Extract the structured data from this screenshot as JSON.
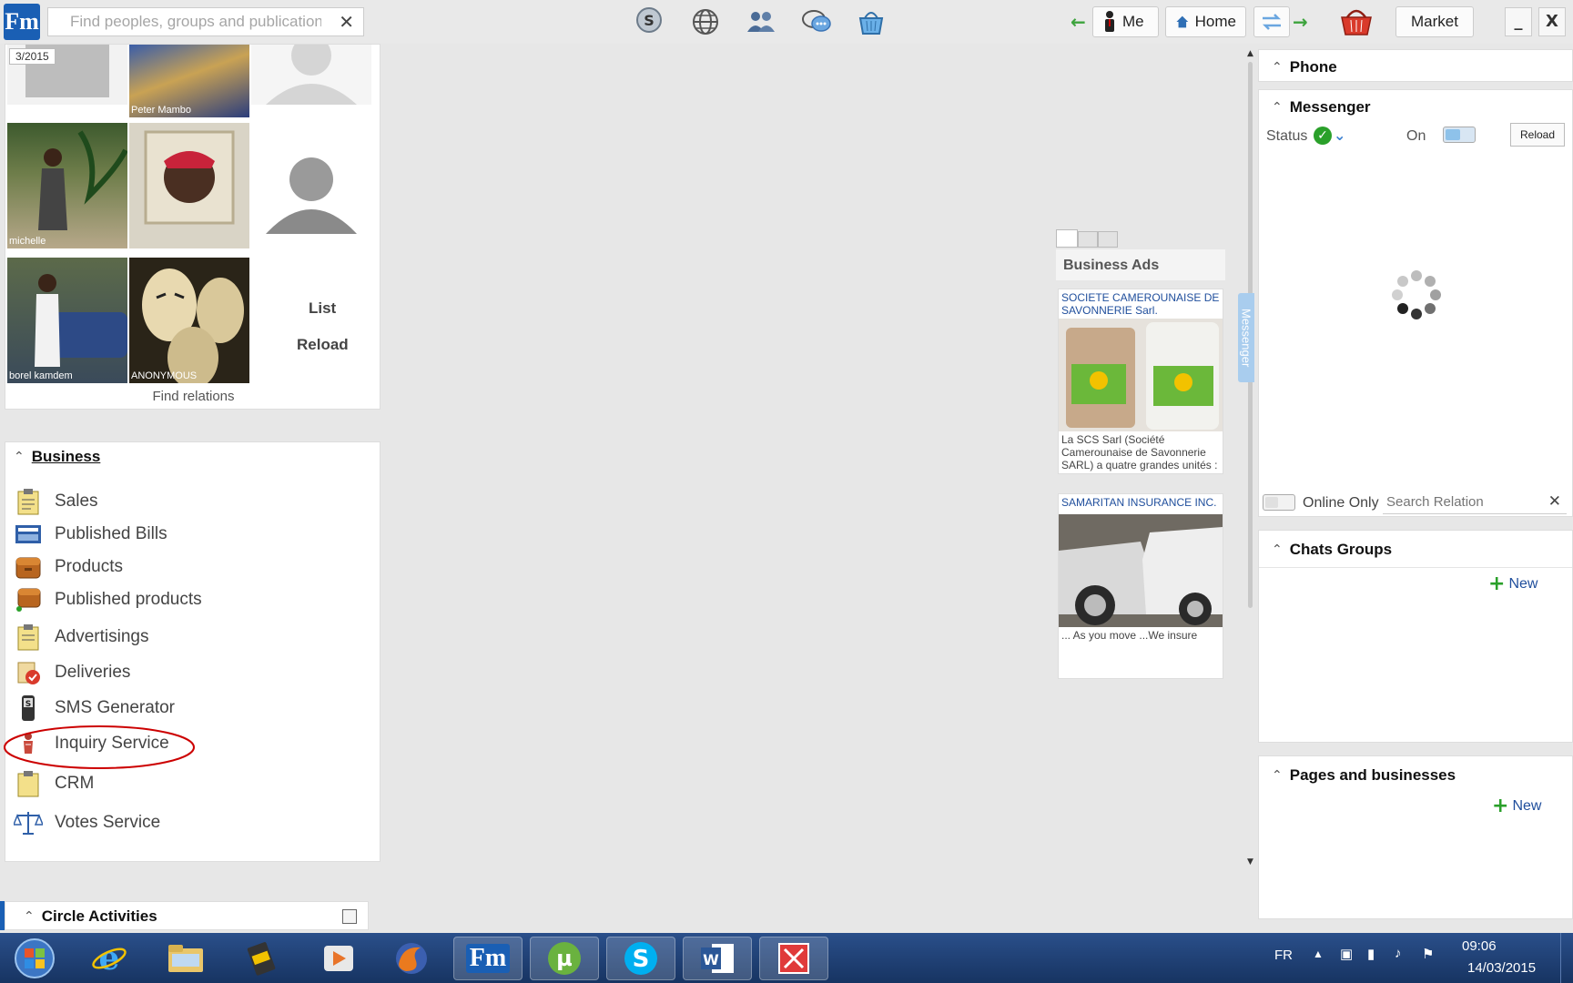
{
  "topbar": {
    "logo": "Fm",
    "search_placeholder": "Find peoples, groups and publications",
    "me_label": "Me",
    "home_label": "Home",
    "market_label": "Market",
    "minimize_label": "_",
    "close_label": "X"
  },
  "relations": {
    "date_badge": "3/2015",
    "names": [
      "Peter Mambo",
      "michelle",
      "borel kamdem",
      "ANONYMOUS"
    ],
    "list_label": "List",
    "reload_label": "Reload",
    "find_label": "Find relations"
  },
  "business": {
    "title": "Business",
    "items": [
      "Sales",
      "Published Bills",
      "Products",
      "Published products",
      "Advertisings",
      "Deliveries",
      "SMS Generator",
      "Inquiry Service",
      "CRM",
      "Votes Service"
    ]
  },
  "circle": {
    "title": "Circle Activities"
  },
  "ads": {
    "title": "Business Ads",
    "items": [
      {
        "title": "SOCIETE CAMEROUNAISE DE SAVONNERIE Sarl.",
        "desc": "La SCS Sarl (Société Camerounaise de Savonnerie SARL) a quatre grandes unités :"
      },
      {
        "title": "SAMARITAN INSURANCE INC.",
        "desc": "... As you move ...We insure"
      }
    ],
    "messenger_tab": "Messenger"
  },
  "right": {
    "phone_title": "Phone",
    "messenger_title": "Messenger",
    "status_label": "Status",
    "on_label": "On",
    "reload_label": "Reload",
    "online_only_label": "Online Only",
    "search_placeholder": "Search Relation",
    "chats_title": "Chats Groups",
    "new_label": "New",
    "pages_title": "Pages and businesses"
  },
  "taskbar": {
    "lang": "FR",
    "time": "09:06",
    "date": "14/03/2015"
  },
  "colors": {
    "accent": "#1f4e9c",
    "highlight_circle": "#cc0000",
    "taskbar": "#1f3f73"
  }
}
